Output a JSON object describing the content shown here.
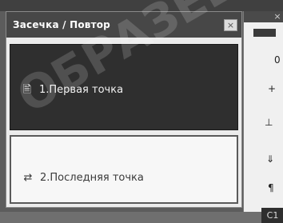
{
  "dialog": {
    "title": "Засечка / Повтор",
    "close_symbol": "×",
    "items": [
      {
        "icon": "document-icon",
        "icon_glyph": "🗎",
        "label": "1.Первая точка",
        "selected": true
      },
      {
        "icon": "repeat-arrows-icon",
        "icon_glyph": "⇄",
        "label": "2.Последняя точка",
        "selected": false
      }
    ]
  },
  "side_panel": {
    "glyphs": [
      "0",
      "+",
      "⊥",
      "⇓",
      "¶"
    ],
    "close_symbol": "×",
    "bottom_button": "C1"
  },
  "watermark": {
    "text": "ОБРАЗЕЦ"
  },
  "colors": {
    "titlebar": "#474747",
    "selected_item_bg": "#2f2f2f",
    "unselected_item_bg": "#f7f7f7"
  }
}
